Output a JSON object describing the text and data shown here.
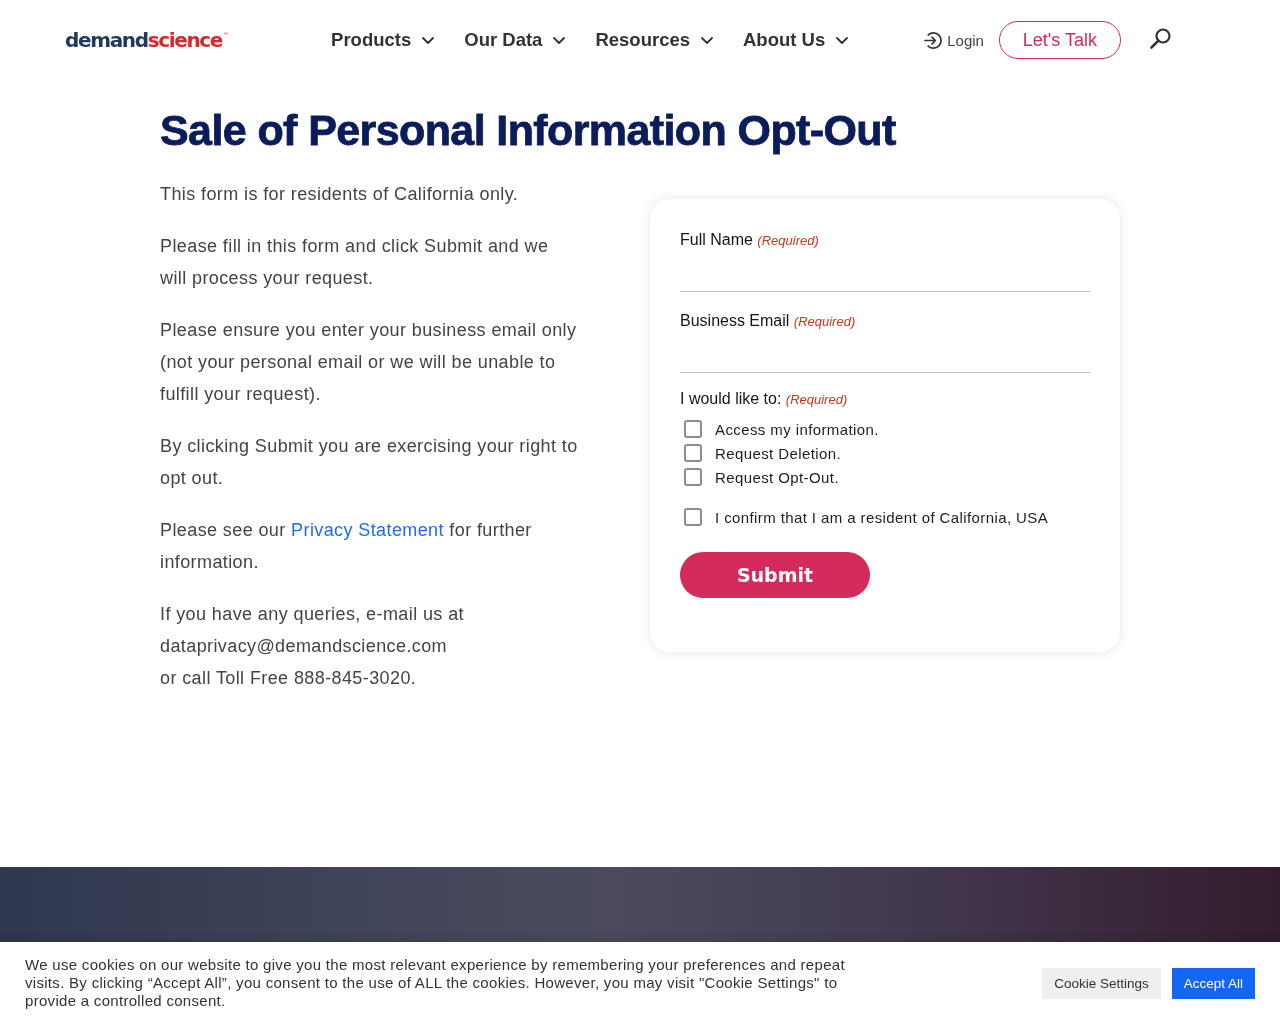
{
  "header": {
    "logo": {
      "dark_part": "demand",
      "red_part": "science",
      "trademark": "™"
    },
    "nav": [
      {
        "label": "Products",
        "has_dropdown": true
      },
      {
        "label": "Our Data",
        "has_dropdown": true
      },
      {
        "label": "Resources",
        "has_dropdown": true
      },
      {
        "label": "About Us",
        "has_dropdown": true
      }
    ],
    "login": "Login",
    "cta": "Let's Talk"
  },
  "page": {
    "title": "Sale of Personal Information Opt-Out",
    "intro": [
      {
        "kind": "plain",
        "text": "This form is for residents of California only."
      },
      {
        "kind": "plain",
        "text": "Please fill in this form and click Submit and we will process your request."
      },
      {
        "kind": "plain",
        "text": "Please ensure you enter your business email only (not your personal email or we will be unable to fulfill your request)."
      },
      {
        "kind": "plain",
        "text": "By clicking Submit you are exercising your right to opt out."
      },
      {
        "kind": "with_link",
        "before": "Please see our ",
        "link": "Privacy Statement",
        "after": " for further information."
      },
      {
        "kind": "lines",
        "lines": [
          "If you have any queries, e-mail us at dataprivacy@demandscience.com",
          "or call Toll Free 888-845-3020."
        ]
      }
    ]
  },
  "form": {
    "fields": [
      {
        "kind": "text",
        "label": "Full Name",
        "required": "(Required)"
      },
      {
        "kind": "text",
        "label": "Business Email",
        "required": "(Required)"
      },
      {
        "kind": "checkboxes",
        "label": "I would like to:",
        "required": "(Required)",
        "options": [
          {
            "label": "Access my information.",
            "checked": false
          },
          {
            "label": "Request Deletion.",
            "checked": false
          },
          {
            "label": "Request Opt-Out.",
            "checked": false
          }
        ]
      }
    ],
    "confirm": {
      "label": "I confirm that I am a resident of California, USA",
      "checked": false
    },
    "submit": "Submit"
  },
  "cookie_banner": {
    "text": "We use cookies on our website to give you the most relevant experience by remembering your preferences and repeat visits. By clicking “Accept All”, you consent to the use of ALL the cookies. However, you may visit \"Cookie Settings\" to provide a controlled consent.",
    "buttons": [
      {
        "label": "Cookie Settings",
        "kind": "secondary"
      },
      {
        "label": "Accept All",
        "kind": "primary"
      }
    ]
  }
}
